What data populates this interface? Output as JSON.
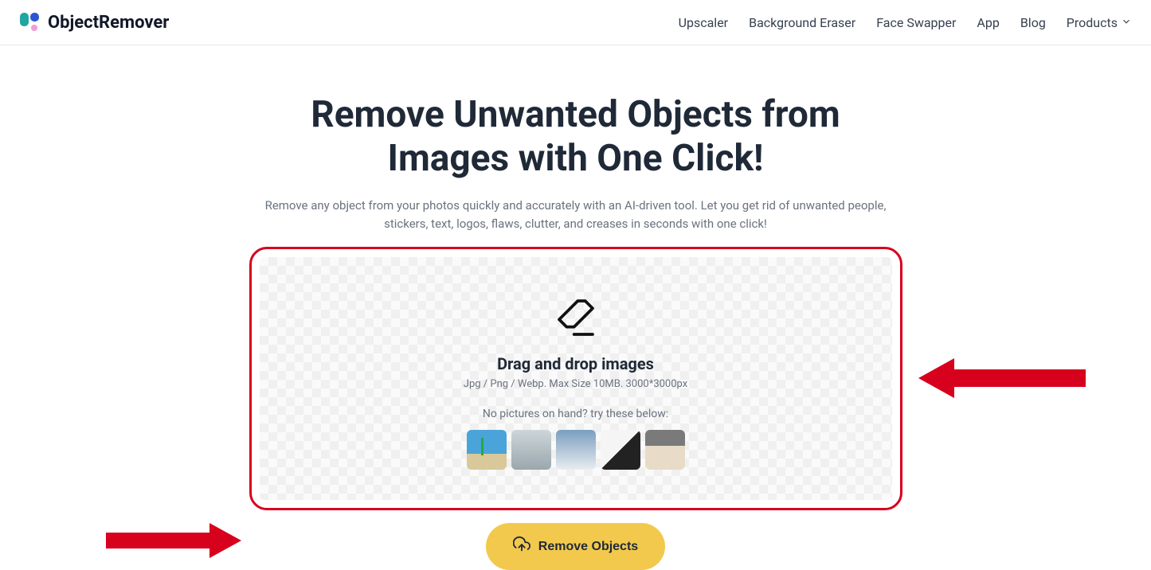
{
  "brand": {
    "name": "ObjectRemover"
  },
  "nav": {
    "items": [
      {
        "label": "Upscaler"
      },
      {
        "label": "Background Eraser"
      },
      {
        "label": "Face Swapper"
      },
      {
        "label": "App"
      },
      {
        "label": "Blog"
      }
    ],
    "products_label": "Products"
  },
  "hero": {
    "title": "Remove Unwanted Objects from Images with One Click!",
    "subtitle": "Remove any object from your photos quickly and accurately with an AI-driven tool. Let you get rid of unwanted people, stickers, text, logos, flaws, clutter, and creases in seconds with one click!"
  },
  "dropzone": {
    "title": "Drag and drop images",
    "spec": "Jpg / Png / Webp. Max Size 10MB. 3000*3000px",
    "try_label": "No pictures on hand? try these below:",
    "samples": [
      {
        "name": "beach-palm"
      },
      {
        "name": "surfer"
      },
      {
        "name": "skier"
      },
      {
        "name": "desk-laptop"
      },
      {
        "name": "hand-object"
      }
    ]
  },
  "cta": {
    "label": "Remove Objects"
  }
}
